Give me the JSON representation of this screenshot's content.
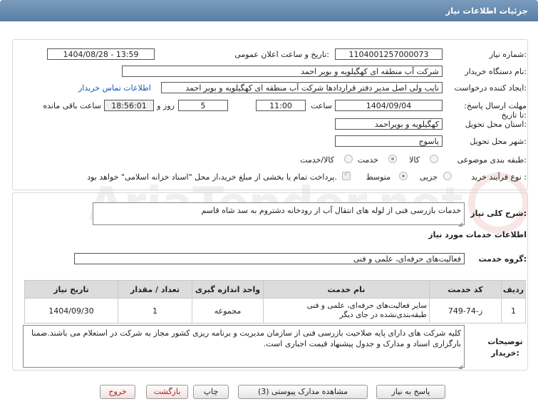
{
  "window": {
    "title": "جزئیات اطلاعات نیاز"
  },
  "watermark": {
    "text": "AriaTender.net"
  },
  "need": {
    "number_label": "شماره نیاز:",
    "number": "1104001257000073",
    "announce_label": "تاریخ و ساعت اعلان عمومی:",
    "announce_value": "1404/08/28 - 13:59",
    "buyer_label": "نام دستگاه خریدار:",
    "buyer": "شرکت آب منطقه ای کهگیلویه و بویر احمد",
    "creator_label": "ایجاد کننده درخواست:",
    "creator": "نایب ولی اصل مدیر دفتر قراردادها شرکت آب منطقه ای کهگیلویه و بویر احمد",
    "contact_link": "اطلاعات تماس خریدار",
    "deadline_label": "مهلت ارسال پاسخ: تا تاریخ:",
    "deadline_date": "1404/09/04",
    "time_label": "ساعت",
    "deadline_time": "11:00",
    "days_value": "5",
    "days_label": "روز و",
    "remaining_time": "18:56:01",
    "remaining_label": "ساعت باقی مانده",
    "province_label": "استان محل تحویل:",
    "province": "کهگیلویه و بویراحمد",
    "city_label": "شهر محل تحویل:",
    "city": "یاسوج",
    "category_label": "طبقه بندی موضوعی:",
    "category_options": [
      "کالا",
      "خدمت",
      "کالا/خدمت"
    ],
    "category_selected": "خدمت",
    "process_label": "نوع فرآیند خرید :",
    "process_options": [
      "جزیی",
      "متوسط"
    ],
    "process_selected": "متوسط",
    "payment_note": "پرداخت تمام یا بخشی از مبلغ خرید،از محل \"اسناد خزانه اسلامی\" خواهد بود."
  },
  "details": {
    "summary_label": "شرح کلی نیاز:",
    "summary": "خدمات بازرسی فنی از لوله های انتقال آب از رودخانه دشتروم به سد شاه قاسم",
    "services_heading": "اطلاعات خدمات مورد نیاز",
    "service_group_label": "گروه خدمت:",
    "service_group": "فعالیت‌های حرفه‌ای، علمی و فنی",
    "table": {
      "headers": [
        "ردیف",
        "کد خدمت",
        "نام خدمت",
        "واحد اندازه گیری",
        "تعداد / مقدار",
        "تاریخ نیاز"
      ],
      "rows": [
        [
          "1",
          "ز-74-749",
          "سایر فعالیت‌های حرفه‌ای، علمی و فنی طبقه‌بندی‌نشده در جای دیگر",
          "مجموعه",
          "1",
          "1404/09/30"
        ]
      ]
    },
    "buyer_notes_label": "توضیحات خریدار:",
    "buyer_notes": "کلیه شرکت های دارای پایه صلاحیت بازرسی فنی از سازمان مدیریت و برنامه ریزی کشور مجاز به شرکت در استعلام می باشند.ضمنا بارگزاری اسناد و مدارک و جدول پیشنهاد قیمت اجباری است."
  },
  "buttons": {
    "reply": "پاسخ به نیاز",
    "attachments": "مشاهده مدارک پیوستی (3)",
    "print": "چاپ",
    "back": "بازگشت",
    "exit": "خروج"
  }
}
